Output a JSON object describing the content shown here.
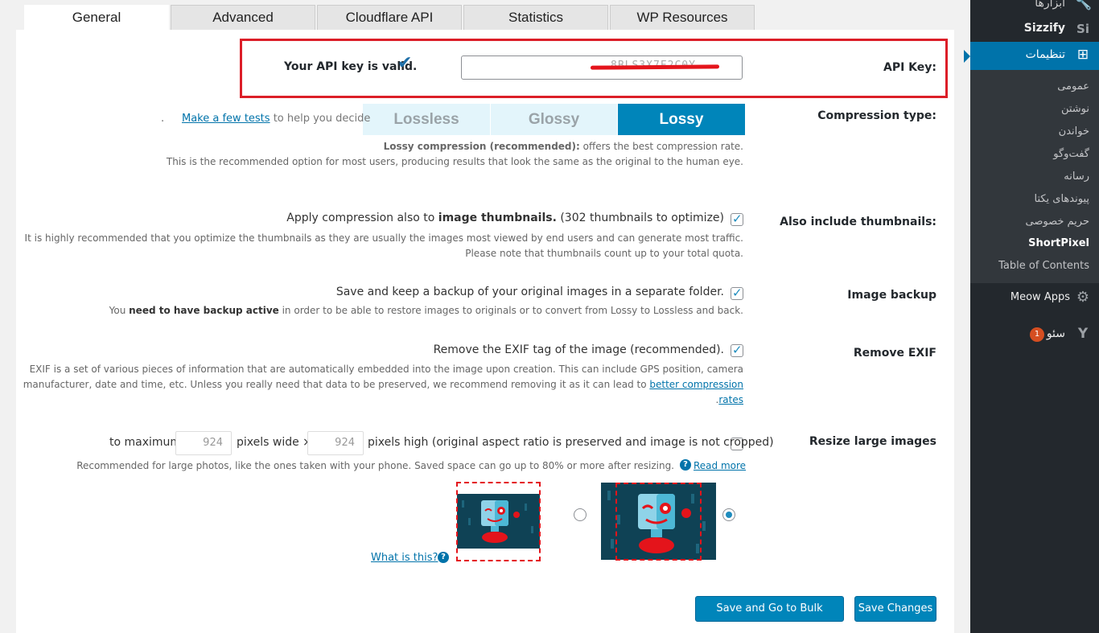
{
  "tabs": [
    "General",
    "Advanced",
    "Cloudflare API",
    "Statistics",
    "WP Resources"
  ],
  "api_key": {
    "label": "API Key:",
    "valid_text": "Your API key is valid.",
    "masked_value": "8BLS3X7F2C0Y"
  },
  "compression": {
    "label": "Compression type:",
    "options": [
      "Lossless",
      "Glossy",
      "Lossy"
    ],
    "selected": "Lossy",
    "tests_link": "Make a few tests",
    "tests_text": " to help you decide",
    "dot": ".",
    "desc_bold": "Lossy compression (recommended):",
    "desc_rest": " offers the best compression rate.",
    "desc_line2": "This is the recommended option for most users, producing results that look the same as the original to the human eye."
  },
  "thumbnails": {
    "label": "Also include thumbnails:",
    "text_pre": "Apply compression also to ",
    "text_bold": "image thumbnails.",
    "text_post": " (302 thumbnails to optimize)",
    "desc1": "It is highly recommended that you optimize the thumbnails as they are usually the images most viewed by end users and can generate most traffic.",
    "desc2": "Please note that thumbnails count up to your total quota."
  },
  "backup": {
    "label": "Image backup",
    "text": "Save and keep a backup of your original images in a separate folder.",
    "desc_pre": "You ",
    "desc_bold": "need to have backup active",
    "desc_post": " in order to be able to restore images to originals or to convert from Lossy to Lossless and back."
  },
  "exif": {
    "label": "Remove EXIF",
    "text": "Remove the EXIF tag of the image (recommended).",
    "desc1": "EXIF is a set of various pieces of information that are automatically embedded into the image upon creation. This can include GPS position, camera",
    "desc2": "manufacturer, date and time, etc. Unless you really need that data to be preserved, we recommend removing it as it can lead to ",
    "desc2_link": "better compression",
    "desc3_link": "rates",
    "desc3_dot": "."
  },
  "resize": {
    "label": "Resize large images",
    "to_max": "to maximum",
    "width": "924",
    "pixels_wide": "pixels wide ×",
    "height": "924",
    "pixels_high": "pixels high (original aspect ratio is preserved and image is not cropped)",
    "desc": "Recommended for large photos, like the ones taken with your phone. Saved space can go up to 80% or more after resizing.",
    "read_more": "Read more",
    "what_is_this": "What is this?"
  },
  "buttons": {
    "bulk": "Save and Go to Bulk Process",
    "save": "Save Changes"
  },
  "sidebar": {
    "tools": "ابزارها",
    "sizzify": "Sizzify",
    "settings": "تنظیمات",
    "sub": [
      "عمومی",
      "نوشتن",
      "خواندن",
      "گفت‌وگو",
      "رسانه",
      "پیوندهای یکتا",
      "حریم خصوصی",
      "ShortPixel",
      "Table of Contents"
    ],
    "meow": "Meow Apps",
    "seo": "سئو",
    "seo_badge": "1"
  },
  "colors": {
    "accent": "#0073aa",
    "lossy_bg": "#0085ba",
    "red_frame": "#dc1e28",
    "sidebar_bg": "#23282d"
  }
}
